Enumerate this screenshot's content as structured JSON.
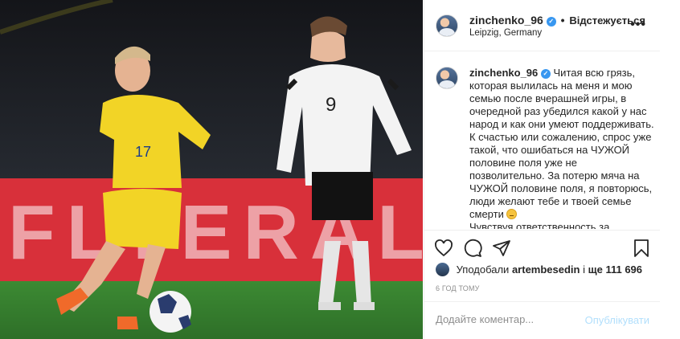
{
  "post": {
    "username": "zinchenko_96",
    "verified_mark": "✓",
    "dot": "•",
    "follow_status": "Відстежується",
    "location": "Leipzig, Germany",
    "more_icon": "•••",
    "caption": "Читая всю грязь, которая вылилась на меня и мою семью после вчерашней игры, в очередной раз убедился какой у нас народ и как они умеют поддерживать. К счастью или сожалению, спрос уже такой, что ошибаться на ЧУЖОЙ половине поля уже не позволительно. За потерю мяча на ЧУЖОЙ половине поля, я повторюсь, люди желают тебе и твоей семье смерти",
    "caption_tail": "Чувствуя ответственность за",
    "likes_prefix": "Уподобали",
    "likes_user": "artembesedin",
    "likes_and": "і",
    "likes_more": "ще 111 696",
    "time_ago": "6 ГОД ТОМУ",
    "comment_placeholder": "Додайте коментар...",
    "publish_label": "Опублікувати"
  },
  "photo": {
    "player_left_number": "17",
    "player_right_number": "9",
    "banner_text": "FLYERALARM"
  },
  "icons": {
    "like": "heart-icon",
    "comment": "comment-icon",
    "share": "paper-plane-icon",
    "save": "bookmark-icon"
  },
  "colors": {
    "link_blue": "#3897f0",
    "publish_disabled": "#b2dffc",
    "ukraine_yellow": "#f2d426",
    "banner_red": "#d8303a"
  }
}
